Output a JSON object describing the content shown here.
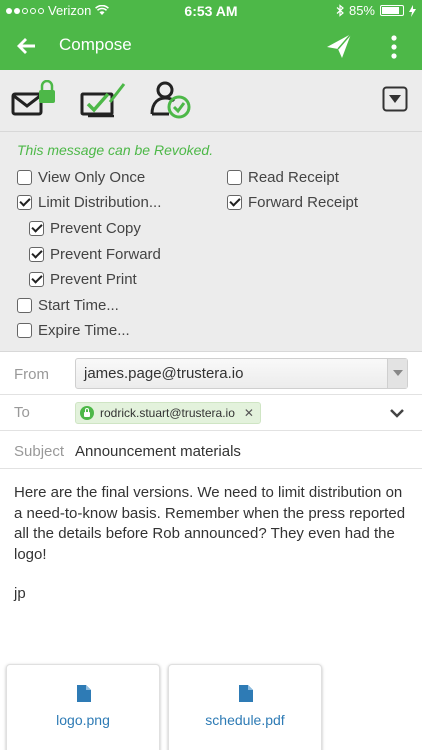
{
  "status": {
    "carrier": "Verizon",
    "time": "6:53 AM",
    "battery": "85%",
    "battery_level": 0.85
  },
  "nav": {
    "title": "Compose"
  },
  "options": {
    "revoke_notice": "This message can be Revoked.",
    "items": [
      {
        "label": "View Only Once",
        "checked": false
      },
      {
        "label": "Limit Distribution...",
        "checked": true
      },
      {
        "label": "Prevent Copy",
        "checked": true
      },
      {
        "label": "Prevent Forward",
        "checked": true
      },
      {
        "label": "Prevent Print",
        "checked": true
      },
      {
        "label": "Start Time...",
        "checked": false
      },
      {
        "label": "Expire Time...",
        "checked": false
      },
      {
        "label": "Read Receipt",
        "checked": false
      },
      {
        "label": "Forward Receipt",
        "checked": true
      }
    ]
  },
  "form": {
    "from_label": "From",
    "from_value": "james.page@trustera.io",
    "to_label": "To",
    "to_recipient": "rodrick.stuart@trustera.io",
    "subject_label": "Subject",
    "subject_value": "Announcement materials"
  },
  "message": {
    "body": "Here are the final versions. We need to limit distribution on a need-to-know basis. Remember when the press reported all the details before Rob announced? They even had the logo!",
    "signature": "jp"
  },
  "attachments": [
    {
      "name": "logo.png",
      "icon": "file-icon"
    },
    {
      "name": "schedule.pdf",
      "icon": "file-icon"
    }
  ],
  "colors": {
    "brand": "#4db848",
    "link": "#2e7bb5"
  }
}
